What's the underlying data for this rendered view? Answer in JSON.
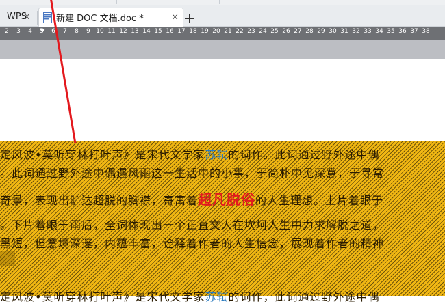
{
  "tabs": [
    {
      "label": "WPS",
      "close": "x"
    },
    {
      "label": "新建 DOC 文档.doc *",
      "close": "×"
    }
  ],
  "add_tab_symbol": "+",
  "ruler": {
    "numbers": [
      "2",
      "3",
      "4",
      "5",
      "6",
      "7",
      "8",
      "9",
      "10",
      "11",
      "12",
      "13",
      "14",
      "15",
      "16",
      "17",
      "18",
      "19",
      "20",
      "21",
      "22",
      "23",
      "24",
      "25",
      "26",
      "27",
      "28",
      "29",
      "30",
      "31",
      "32",
      "33",
      "34",
      "35",
      "36",
      "37",
      "38"
    ]
  },
  "document": {
    "lines": [
      {
        "parts": [
          {
            "text": "定风波•莫听穿林打叶声》是宋代文学家"
          },
          {
            "text": "苏轼",
            "style": "blue"
          },
          {
            "text": "的词作。此词通过野外途中偶"
          }
        ]
      },
      {
        "parts": [
          {
            "text": "。此词通过野外途中偶遇风雨这一生活中的小事，于简朴中见深意，于寻常"
          }
        ]
      },
      {
        "parts": [
          {
            "text": "奇景，表现出旷达超脱的胸襟，寄寓着"
          },
          {
            "text": "超凡脱俗",
            "style": "red"
          },
          {
            "text": "的人生理想。上片着眼于"
          }
        ]
      },
      {
        "parts": [
          {
            "text": "。下片着眼于雨后，全词体现出一个正直文人在坎坷人生中力求解脱之道，"
          }
        ]
      },
      {
        "parts": [
          {
            "text": "黑短，但意境深邃，内蕴丰富，诠释着作者的人生信念，展现着作者的精神"
          }
        ]
      },
      {
        "parts": [
          {
            "text": "定风波•莫听穿林打叶声》是宋代文学家"
          },
          {
            "text": "苏轼",
            "style": "blue"
          },
          {
            "text": "的词作，此词通过野外途中偶"
          }
        ]
      }
    ]
  },
  "colors": {
    "selection": "#f1b713",
    "ruler": "#6e7074",
    "arrow": "#e3191e",
    "highlight_red": "#e3191e",
    "highlight_blue": "#2b7bbf"
  }
}
